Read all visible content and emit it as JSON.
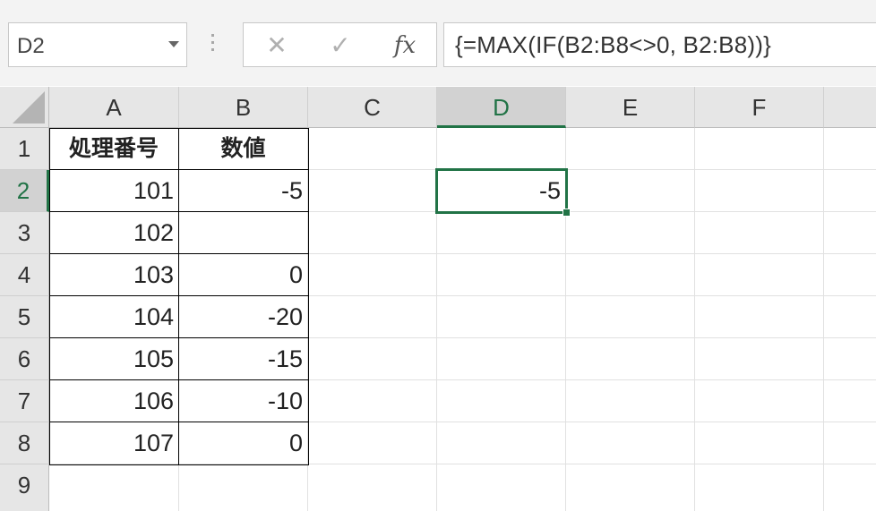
{
  "formula_bar": {
    "name_box": "D2",
    "cancel_symbol": "✕",
    "enter_symbol": "✓",
    "fx_label": "fx",
    "formula": "{=MAX(IF(B2:B8<>0, B2:B8))}"
  },
  "columns": [
    "A",
    "B",
    "C",
    "D",
    "E",
    "F"
  ],
  "selected_column": "D",
  "rows": [
    "1",
    "2",
    "3",
    "4",
    "5",
    "6",
    "7",
    "8",
    "9"
  ],
  "selected_row": "2",
  "cells": {
    "A1": "処理番号",
    "B1": "数値",
    "A2": "101",
    "B2": "-5",
    "D2": "-5",
    "A3": "102",
    "B3": "",
    "A4": "103",
    "B4": "0",
    "A5": "104",
    "B5": "-20",
    "A6": "105",
    "B6": "-15",
    "A7": "106",
    "B7": "-10",
    "A8": "107",
    "B8": "0"
  },
  "colors": {
    "accent": "#217346",
    "header_bg": "#e6e6e6"
  }
}
